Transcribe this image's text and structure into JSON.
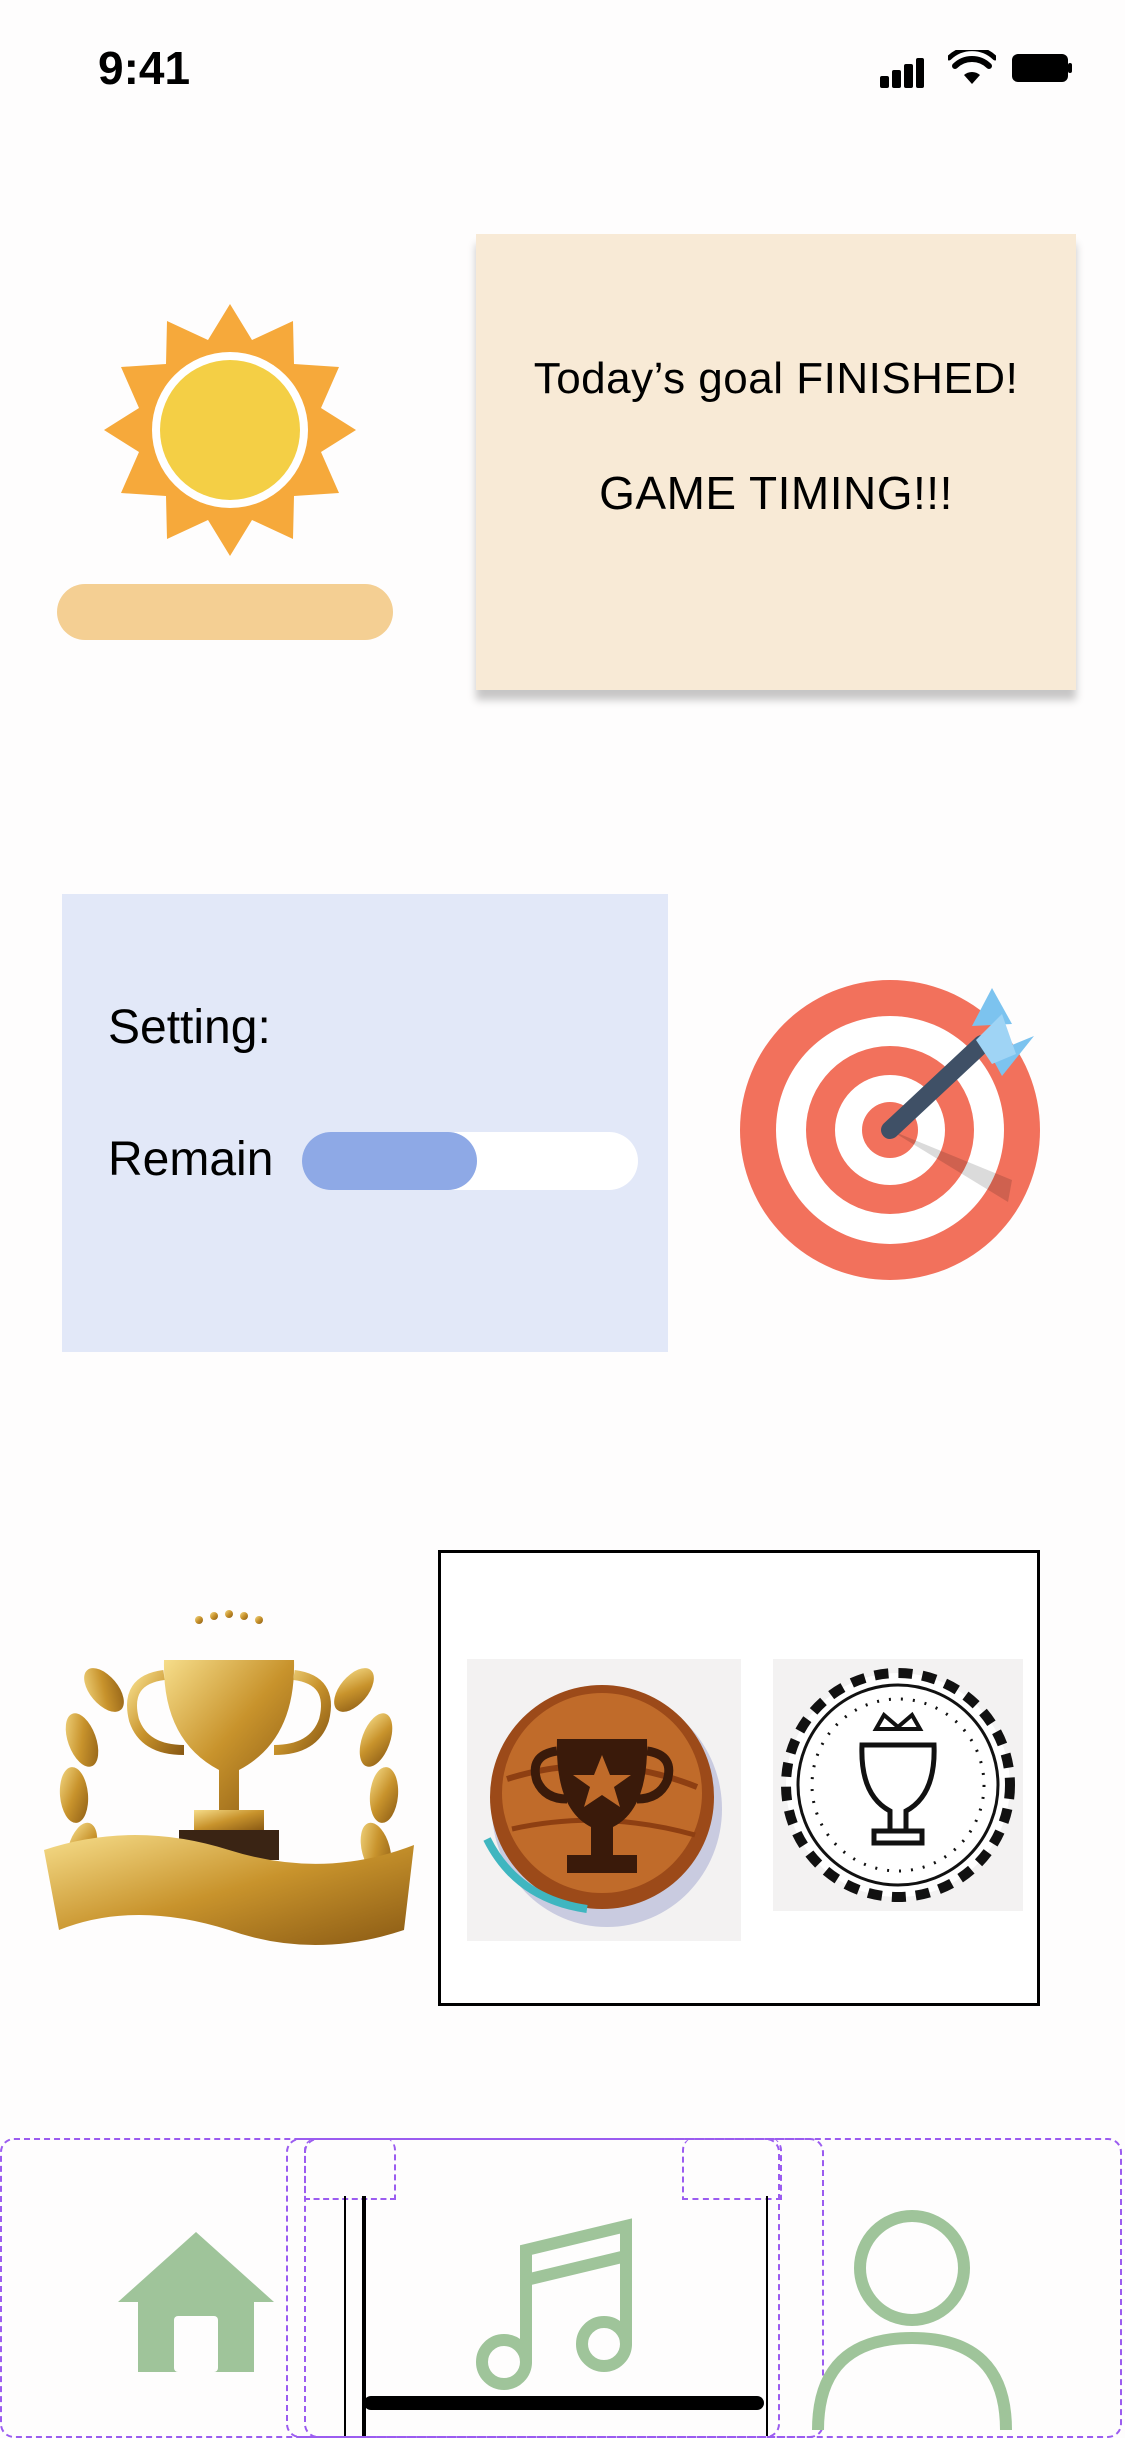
{
  "status_bar": {
    "time": "9:41"
  },
  "goal_card": {
    "line1": "Today’s goal  FINISHED!",
    "line2": "GAME TIMING!!!"
  },
  "setting_card": {
    "setting_label": "Setting:",
    "remain_label": "Remain",
    "remain_progress": 0.52
  },
  "tabs": [
    {
      "name": "home",
      "icon": "home-icon",
      "active": false
    },
    {
      "name": "music",
      "icon": "music-note-icon",
      "active": true
    },
    {
      "name": "profile",
      "icon": "user-icon",
      "active": false
    }
  ],
  "colors": {
    "sun_bar": "#f4cf93",
    "goal_card": "#f8ead6",
    "setting_card": "#e2e8f8",
    "progress_fill": "#8ea9e6",
    "tab_icon": "#9fc49a",
    "guide": "#9b5cf0"
  }
}
